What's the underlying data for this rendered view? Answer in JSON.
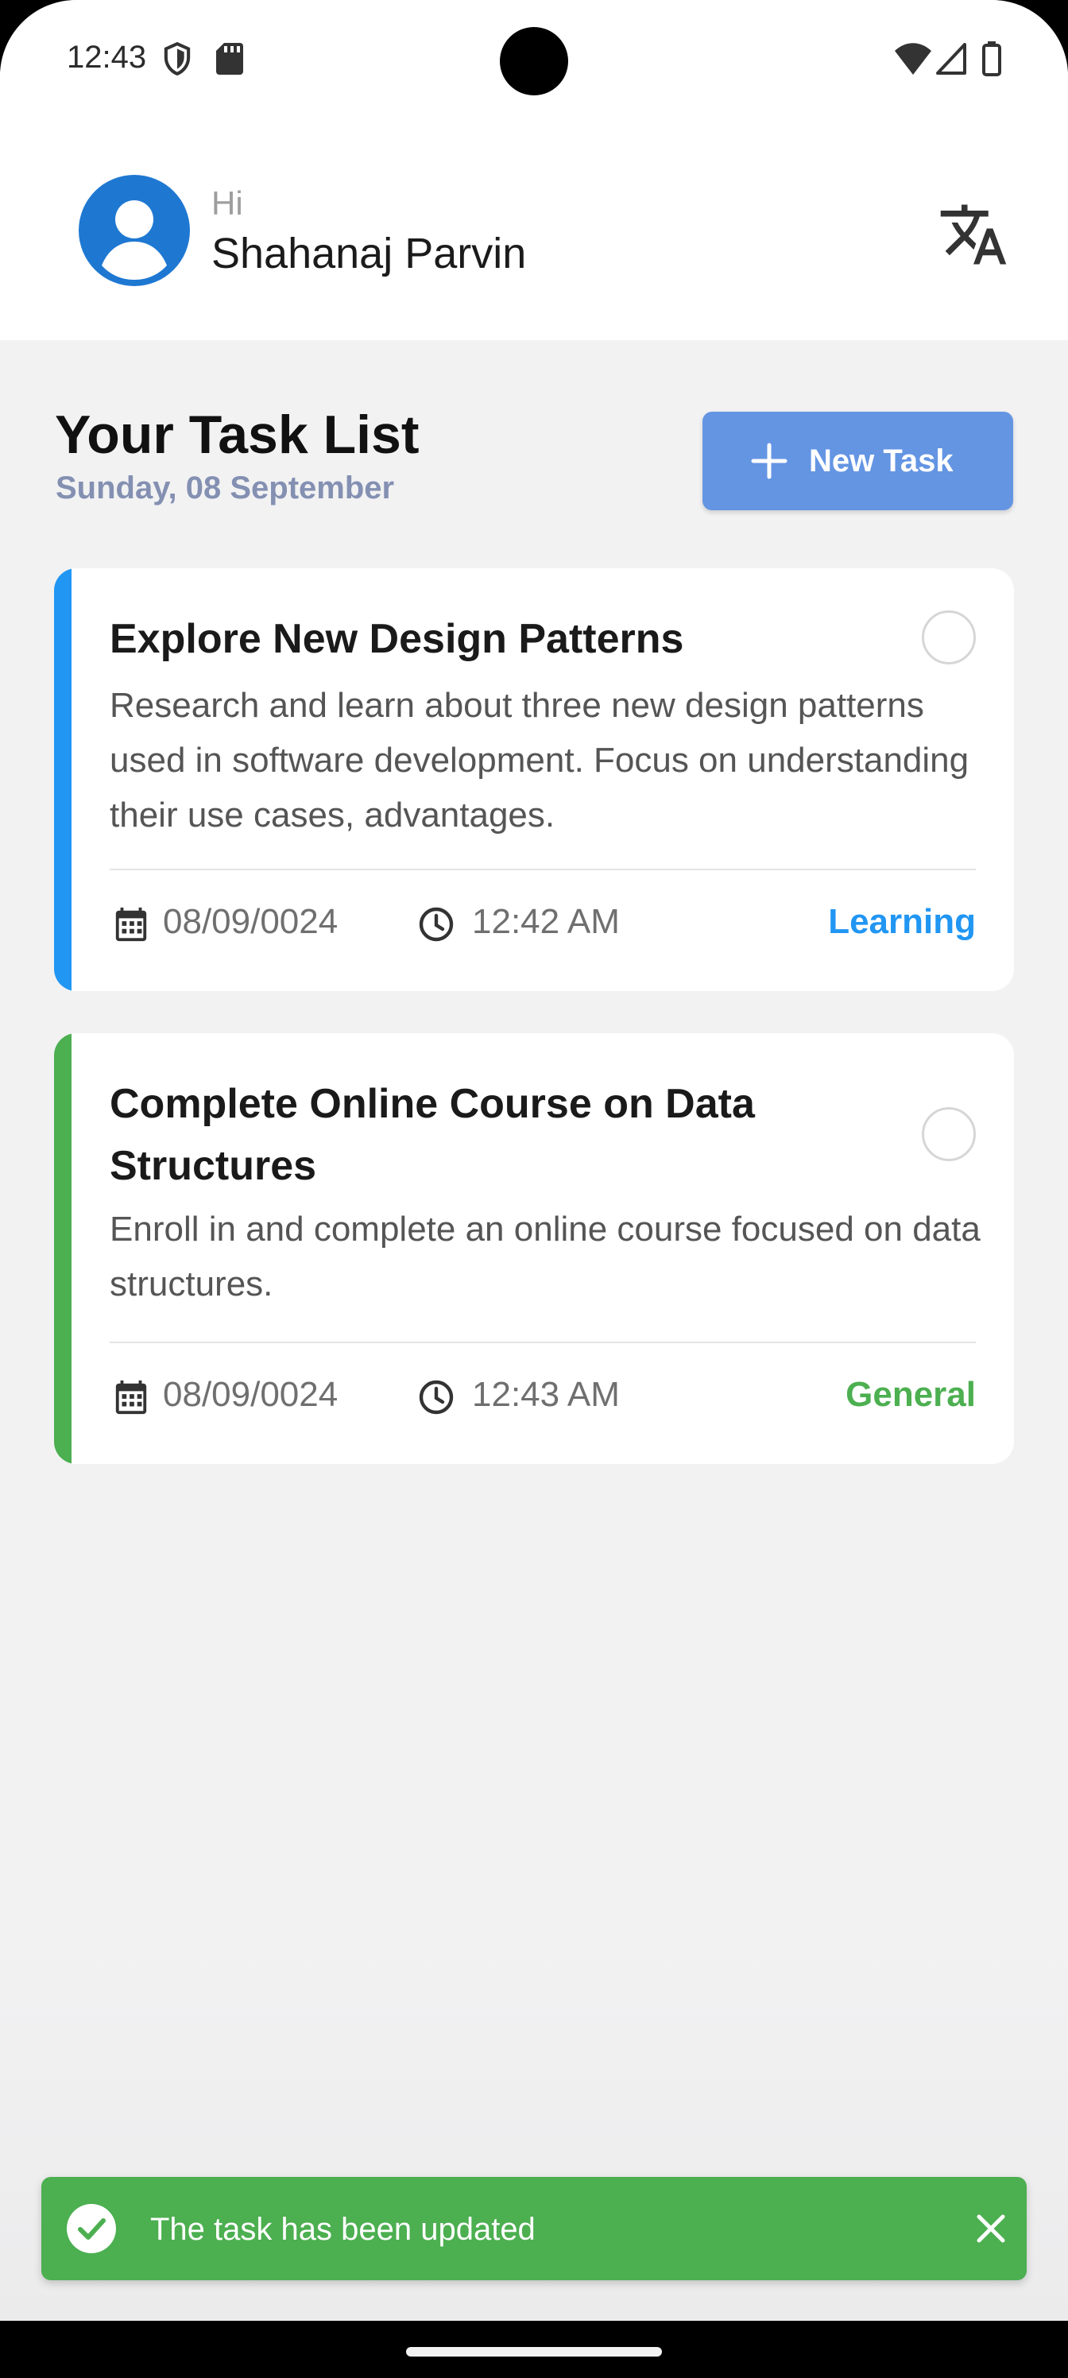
{
  "status_bar": {
    "time": "12:43",
    "icons_left": [
      "shield-icon",
      "sd-card-icon"
    ],
    "icons_right": [
      "wifi-icon",
      "signal-icon",
      "battery-icon"
    ]
  },
  "header": {
    "greeting": "Hi",
    "user_name": "Shahanaj Parvin",
    "avatar_icon": "account-circle-icon",
    "action_icon": "translate-icon"
  },
  "page": {
    "title": "Your Task List",
    "date": "Sunday, 08 September",
    "new_task_label": "New Task"
  },
  "tasks": [
    {
      "title": "Explore New Design Patterns",
      "description": "Research and learn about three new design patterns used in software development. Focus on understanding their use cases, advantages.",
      "date": "08/09/0024",
      "time": "12:42 AM",
      "category": "Learning",
      "color": "#2196f3",
      "completed": false
    },
    {
      "title": "Complete Online Course on Data Structures",
      "description": "Enroll in and complete an online course focused on data structures.",
      "date": "08/09/0024",
      "time": "12:43 AM",
      "category": "General",
      "color": "#4caf50",
      "completed": false
    }
  ],
  "snackbar": {
    "message": "The task has been updated",
    "color": "#4caf50"
  },
  "colors": {
    "accent": "#6495e3",
    "avatar": "#1e78d2",
    "background": "#f2f2f3"
  }
}
